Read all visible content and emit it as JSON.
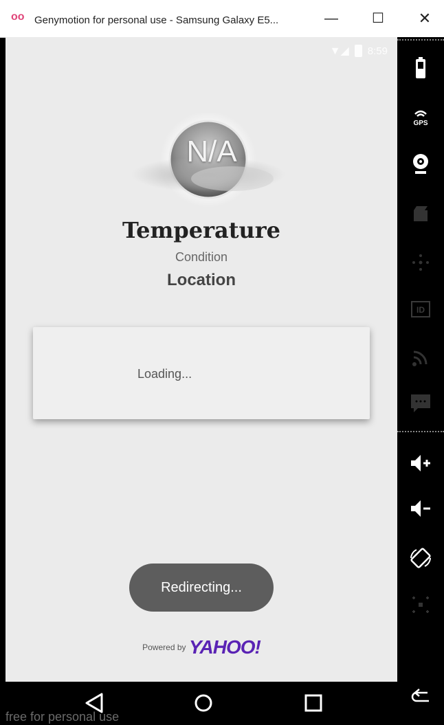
{
  "window": {
    "title": "Genymotion for personal use - Samsung Galaxy E5...",
    "minimize": "—",
    "maximize": "☐",
    "close": "✕"
  },
  "status_bar": {
    "time": "8:59"
  },
  "weather": {
    "icon_text": "N/A",
    "temperature": "Temperature",
    "condition": "Condition",
    "location": "Location"
  },
  "forecast_card": {
    "text": "Loading..."
  },
  "toast": {
    "text": "Redirecting..."
  },
  "footer": {
    "powered_by": "Powered by",
    "brand": "YAHOO!",
    "brand_color": "#5a23b4"
  },
  "watermark": "free for personal use",
  "sidebar_icons": [
    "battery-icon",
    "gps-icon",
    "webcam-icon",
    "screencast-icon",
    "remote-control-icon",
    "device-id-icon",
    "network-icon",
    "sms-icon",
    "volume-up-icon",
    "volume-down-icon",
    "rotate-icon",
    "pixel-perfect-icon",
    "back-icon"
  ],
  "gps_label": "GPS",
  "id_label": "ID"
}
